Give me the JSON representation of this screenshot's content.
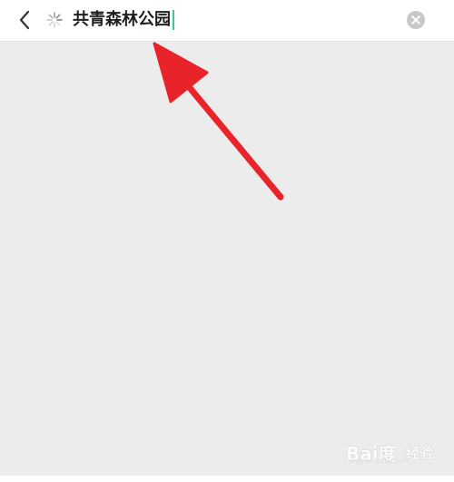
{
  "search": {
    "query": "共青森林公园",
    "placeholder": ""
  },
  "icons": {
    "back": "chevron-left-icon",
    "loading": "loading-spinner-icon",
    "clear": "clear-circle-icon"
  },
  "colors": {
    "header_bg": "#ffffff",
    "content_bg": "#ececec",
    "caret": "#3cc2a4",
    "annotation_arrow": "#e8232a",
    "clear_icon": "#c8c8c8"
  },
  "watermark": {
    "brand": "Bai度",
    "sub": "经验",
    "url": "jingyan.baidu.com"
  }
}
